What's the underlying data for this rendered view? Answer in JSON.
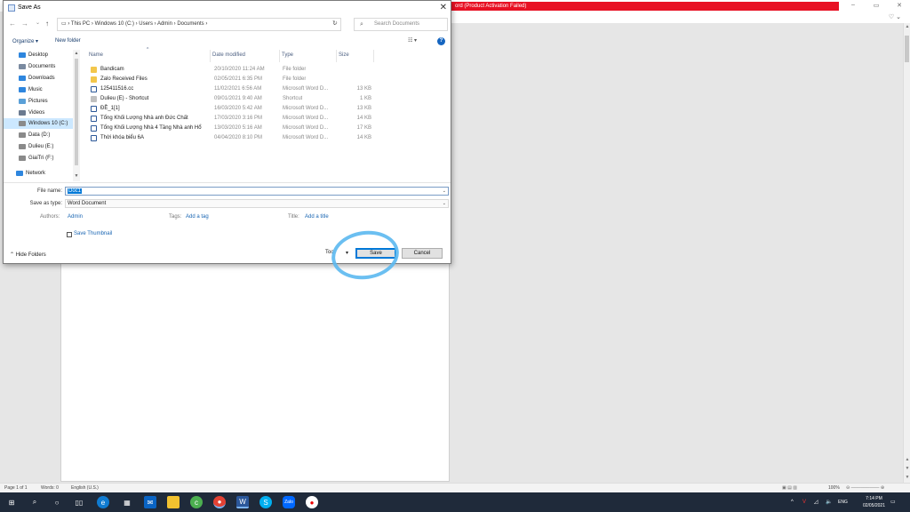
{
  "word": {
    "title_alert": "ord (Product Activation Failed)",
    "win_controls": [
      "–",
      "▭",
      "✕"
    ],
    "status": {
      "page": "Page 1 of 1",
      "words": "Words: 0",
      "language": "English (U.S.)",
      "zoom": "100%"
    }
  },
  "dialog": {
    "title": "Save As",
    "address": {
      "path": [
        "This PC",
        "Windows 10 (C:)",
        "Users",
        "Admin",
        "Documents"
      ]
    },
    "search_placeholder": "Search Documents",
    "toolbar": {
      "organize": "Organize ▾",
      "new_folder": "New folder"
    },
    "nav_items": [
      {
        "label": "Desktop",
        "icon": "desktop-icon",
        "color": "#2e86de"
      },
      {
        "label": "Documents",
        "icon": "documents-icon",
        "color": "#7a8aa0"
      },
      {
        "label": "Downloads",
        "icon": "downloads-icon",
        "color": "#2e86de"
      },
      {
        "label": "Music",
        "icon": "music-icon",
        "color": "#2e86de"
      },
      {
        "label": "Pictures",
        "icon": "pictures-icon",
        "color": "#5aa0d8"
      },
      {
        "label": "Videos",
        "icon": "videos-icon",
        "color": "#6b7a90"
      },
      {
        "label": "Windows 10 (C:)",
        "icon": "drive-icon",
        "color": "#8a8a8a",
        "selected": true
      },
      {
        "label": "Data (D:)",
        "icon": "drive-icon",
        "color": "#8a8a8a"
      },
      {
        "label": "Dulieu (E:)",
        "icon": "drive-icon",
        "color": "#8a8a8a"
      },
      {
        "label": "GiaiTri (F:)",
        "icon": "drive-icon",
        "color": "#8a8a8a"
      },
      {
        "label": "Network",
        "icon": "network-icon",
        "color": "#2e86de"
      }
    ],
    "columns": [
      "Name",
      "Date modified",
      "Type",
      "Size"
    ],
    "files": [
      {
        "name": "Bandicam",
        "date": "20/10/2020 11:24 AM",
        "type": "File folder",
        "size": "",
        "kind": "folder"
      },
      {
        "name": "Zalo Received Files",
        "date": "02/05/2021 6:35 PM",
        "type": "File folder",
        "size": "",
        "kind": "folder"
      },
      {
        "name": "125411516.cc",
        "date": "11/02/2021 6:56 AM",
        "type": "Microsoft Word D...",
        "size": "13 KB",
        "kind": "word"
      },
      {
        "name": "Dulieu (E) - Shortcut",
        "date": "09/01/2021 9:40 AM",
        "type": "Shortcut",
        "size": "1 KB",
        "kind": "shortcut"
      },
      {
        "name": "ĐỀ_1[1]",
        "date": "16/03/2020 5:42 AM",
        "type": "Microsoft Word D...",
        "size": "13 KB",
        "kind": "word"
      },
      {
        "name": "Tổng Khối Lượng Nhà anh Đức Chất",
        "date": "17/03/2020 3:16 PM",
        "type": "Microsoft Word D...",
        "size": "14 KB",
        "kind": "word"
      },
      {
        "name": "Tổng Khối Lượng Nhà 4 Tầng Nhà anh Hổ",
        "date": "13/03/2020 5:16 AM",
        "type": "Microsoft Word D...",
        "size": "17 KB",
        "kind": "word"
      },
      {
        "name": "Thời khóa biểu 6A",
        "date": "04/04/2020 8:10 PM",
        "type": "Microsoft Word D...",
        "size": "14 KB",
        "kind": "word"
      }
    ],
    "form": {
      "file_name_label": "File name:",
      "file_name_value": "Doc1",
      "save_type_label": "Save as type:",
      "save_type_value": "Word Document",
      "authors_label": "Authors:",
      "authors_value": "Admin",
      "tags_label": "Tags:",
      "tags_value": "Add a tag",
      "title_label": "Title:",
      "title_value": "Add a title",
      "thumbnail_label": "Save Thumbnail"
    },
    "footer": {
      "hide_folders": "Hide Folders",
      "tools": "Too",
      "save": "Save",
      "cancel": "Cancel"
    }
  },
  "taskbar": {
    "apps": [
      "start",
      "search",
      "cortana",
      "task-view",
      "edge",
      "store",
      "mail",
      "explorer",
      "coccoc",
      "chrome",
      "word",
      "skype",
      "zalo",
      "record"
    ],
    "lang": "ENG",
    "time": "7:14 PM",
    "date": "02/05/2021"
  }
}
